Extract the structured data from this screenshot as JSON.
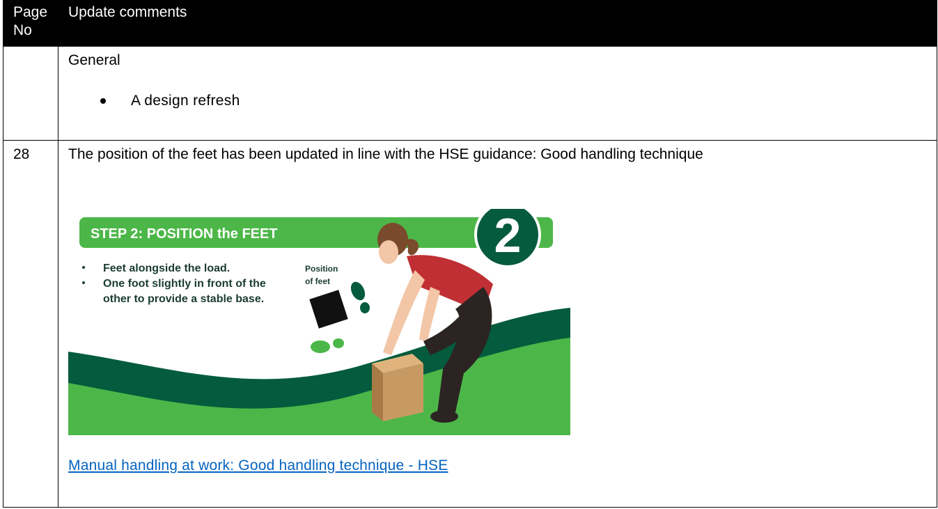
{
  "table": {
    "header": {
      "page_no": "Page No",
      "update_comments": "Update comments"
    },
    "general": {
      "title": "General",
      "bullets": [
        "A design refresh"
      ]
    },
    "row28": {
      "page": "28",
      "text": "The position of the feet has been updated in line with the HSE guidance: Good handling technique",
      "link": "Manual handling at work: Good handling technique - HSE"
    }
  },
  "illustration": {
    "banner": "STEP 2: POSITION the FEET",
    "step_number": "2",
    "bullets": [
      "Feet alongside the load.",
      "One foot slightly in front of the",
      "other to provide a stable base."
    ],
    "position_label_line1": "Position",
    "position_label_line2": "of feet",
    "colors": {
      "green": "#4cb748",
      "dark_green": "#045b3d",
      "shirt": "#c02f34",
      "pants": "#2b2423",
      "box": "#c89a63"
    }
  }
}
